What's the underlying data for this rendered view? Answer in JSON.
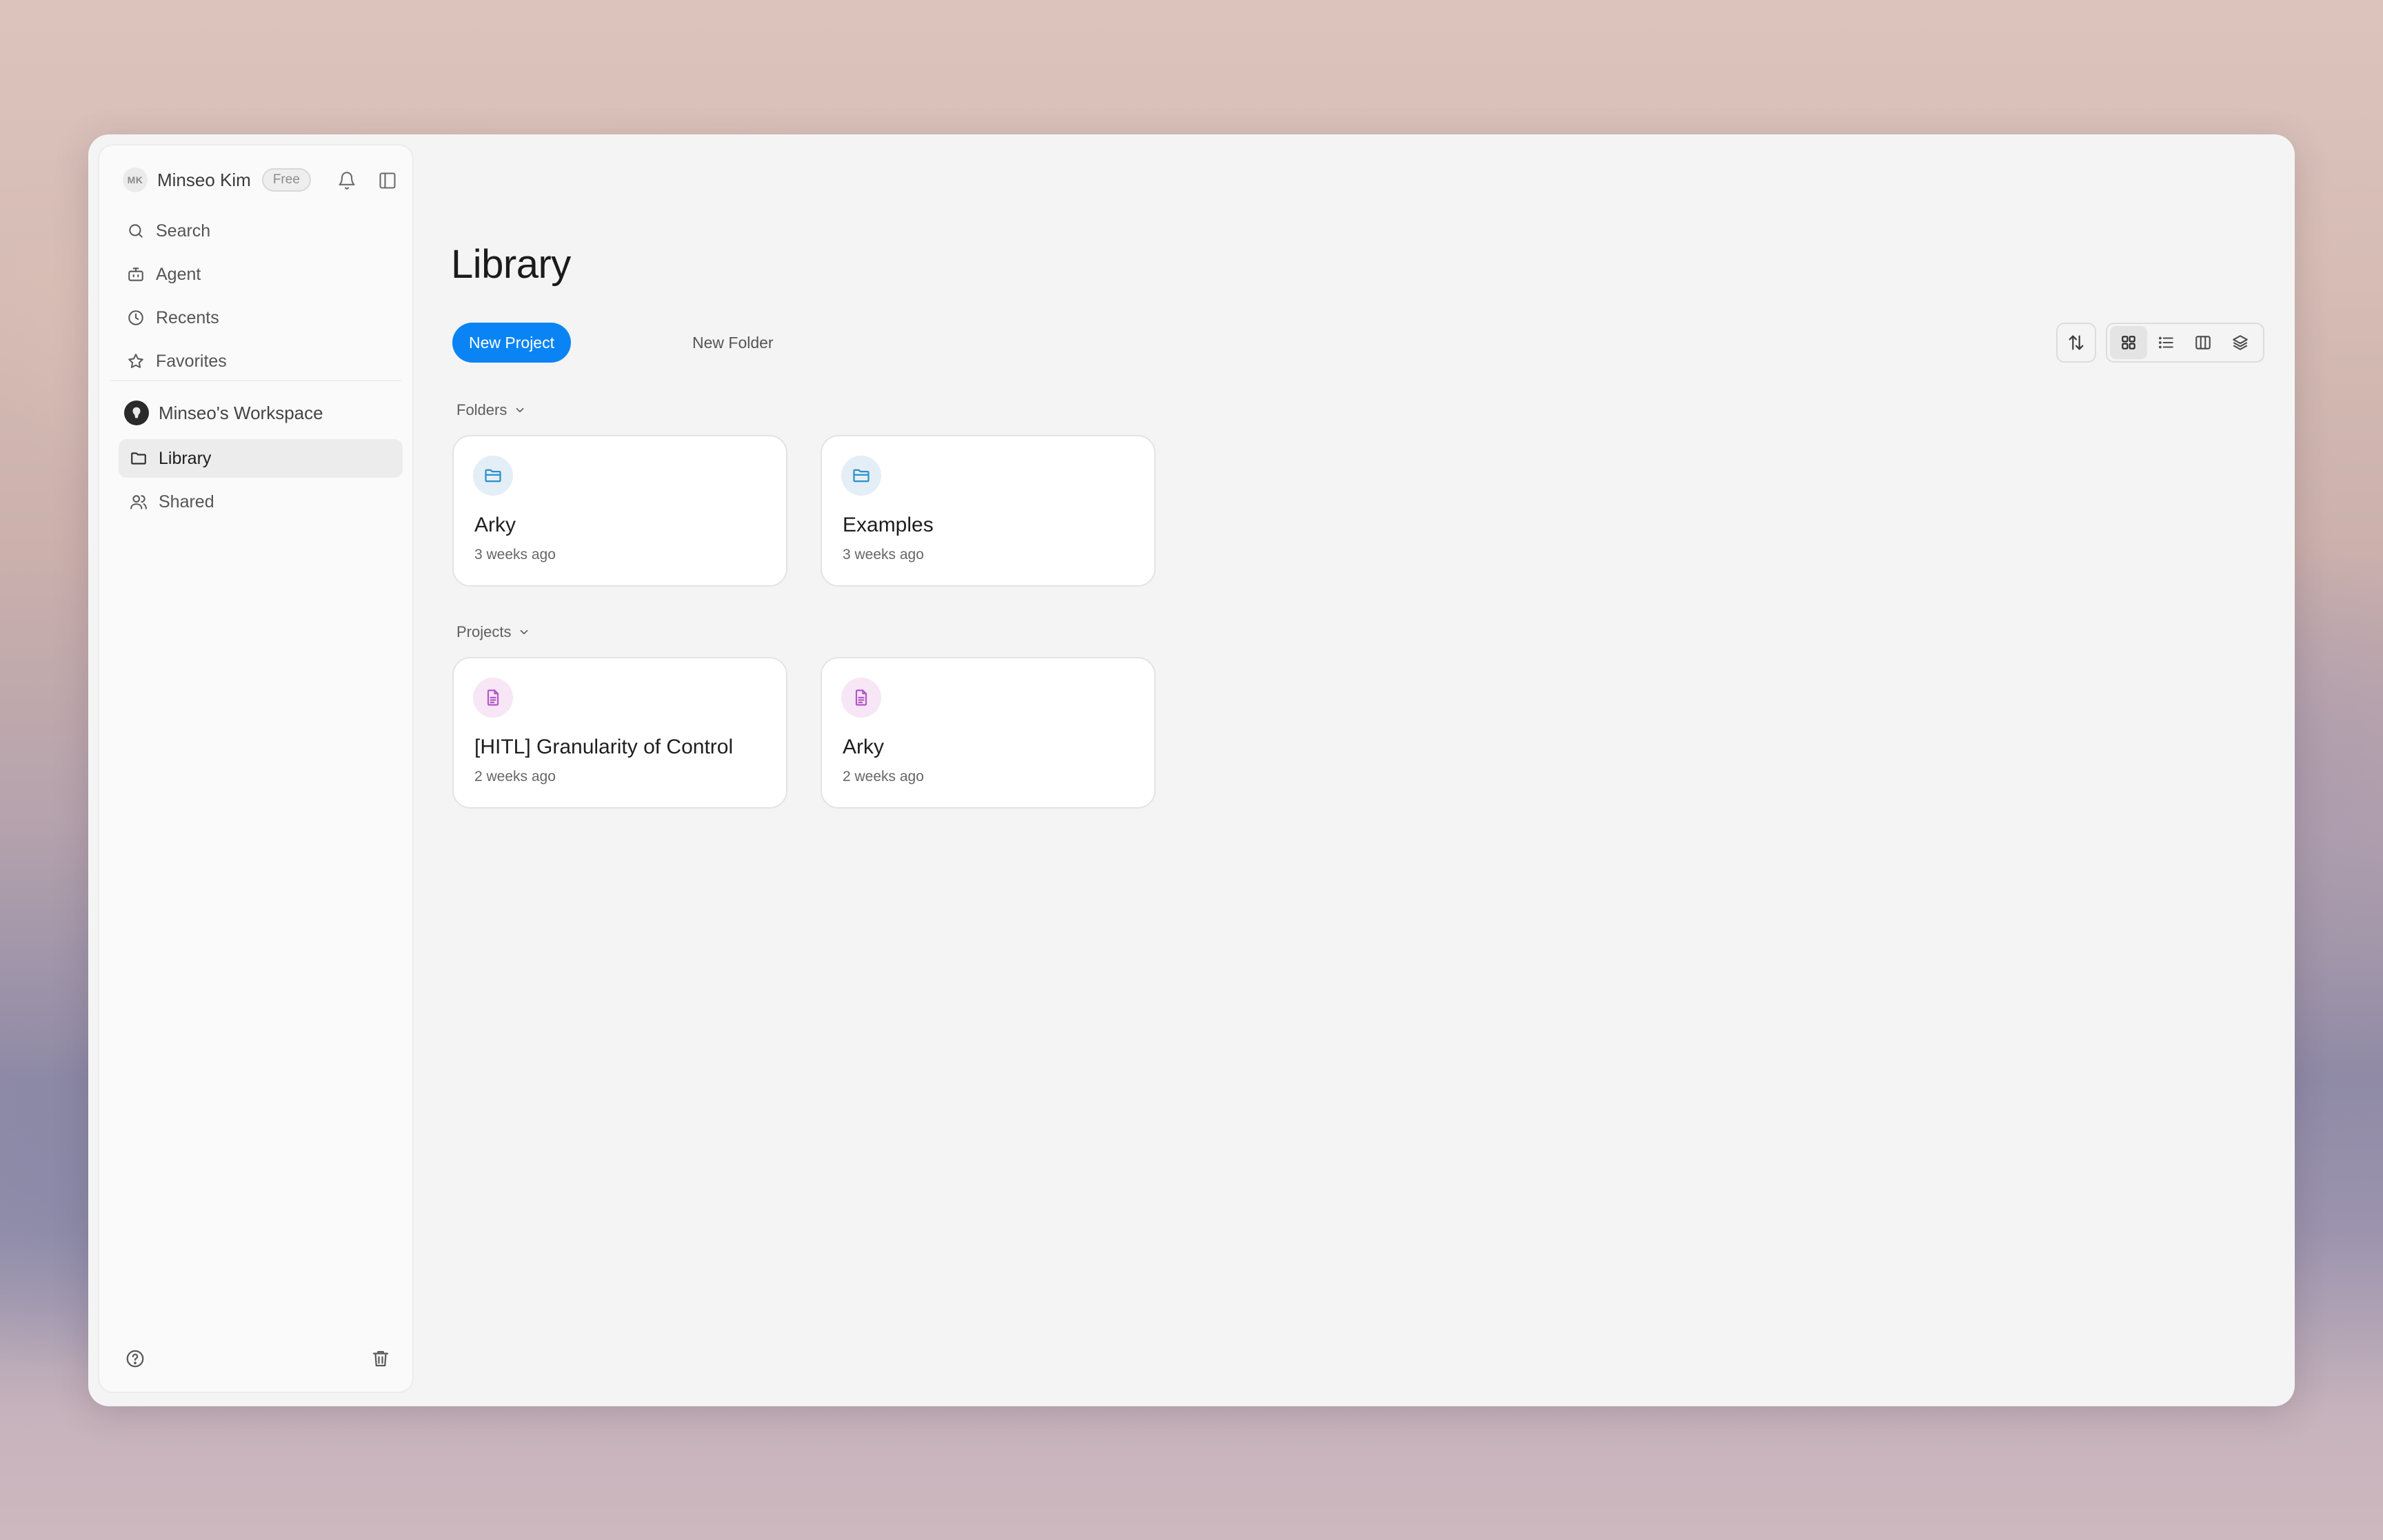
{
  "user": {
    "initials": "MK",
    "name": "Minseo Kim",
    "plan": "Free"
  },
  "nav": {
    "search": "Search",
    "agent": "Agent",
    "recents": "Recents",
    "favorites": "Favorites"
  },
  "workspace": {
    "name": "Minseo's Workspace",
    "library": "Library",
    "shared": "Shared"
  },
  "main": {
    "title": "Library",
    "new_project": "New Project",
    "new_folder": "New Folder",
    "folders_label": "Folders",
    "projects_label": "Projects",
    "folders": [
      {
        "title": "Arky",
        "subtitle": "3 weeks ago"
      },
      {
        "title": "Examples",
        "subtitle": "3 weeks ago"
      }
    ],
    "projects": [
      {
        "title": "[HITL] Granularity of Control",
        "subtitle": "2 weeks ago"
      },
      {
        "title": "Arky",
        "subtitle": "2 weeks ago"
      }
    ]
  },
  "colors": {
    "accent": "#0a84f4",
    "folder_icon": "#2a8fc9",
    "project_icon": "#b457c9"
  },
  "icons": {
    "bell": "bell-icon",
    "sidebar_toggle": "sidebar-toggle-icon",
    "search": "search-icon",
    "agent": "robot-icon",
    "recents": "clock-icon",
    "favorites": "star-icon",
    "library": "folder-icon",
    "shared": "users-icon",
    "help": "help-icon",
    "trash": "trash-icon",
    "sort": "sort-icon",
    "grid": "grid-view-icon",
    "list": "list-view-icon",
    "columns": "columns-view-icon",
    "layers": "layers-view-icon"
  }
}
